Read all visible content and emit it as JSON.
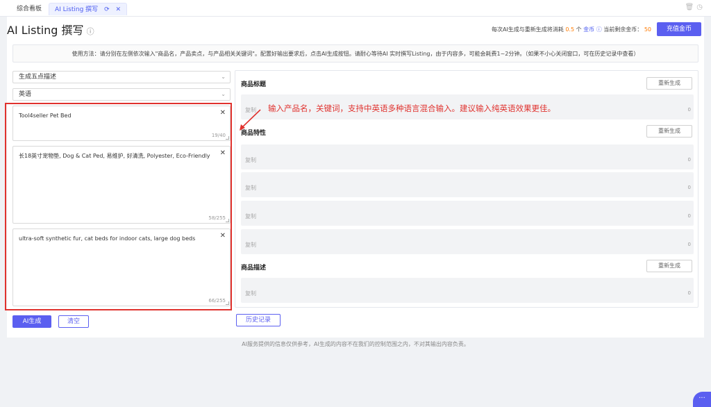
{
  "tabs": [
    {
      "label": "综合看板"
    },
    {
      "label": "AI Listing 撰写",
      "refresh_icon": "⟳",
      "close_icon": "✕"
    }
  ],
  "header": {
    "title": "AI Listing 撰写",
    "cost_prefix": "每次AI生成与重新生成将消耗",
    "cost_value": "0.5",
    "cost_unit": "个",
    "cost_currency": "金币",
    "balance_label": "当前剩余金币：",
    "balance_value": "50",
    "recharge_label": "充值金币"
  },
  "usage_text": "使用方法：请分别在左侧依次输入\"商品名，产品卖点，与产品相关关键词\"。配置好输出要求后，点击AI生成按钮。请耐心等待AI 实时撰写Listing，由于内容多，可能会耗费1~2分钟。（如果不小心关闭窗口，可在历史记录中查看）",
  "left": {
    "select_mode": "生成五点描述",
    "select_language": "英语",
    "inputs": [
      {
        "value": "Tool4seller Pet Bed",
        "count": "19/40"
      },
      {
        "value": "长18英寸宠物垫, Dog & Cat Ped, 易维护, 好清洗, Polyester, Eco-Friendly",
        "count": "58/255"
      },
      {
        "value": "ultra-soft synthetic fur, cat beds for indoor cats, large dog beds",
        "count": "66/255"
      }
    ],
    "generate_label": "AI生成",
    "clear_label": "清空"
  },
  "right": {
    "title_section": "商品标题",
    "features_section": "商品特性",
    "desc_section": "商品描述",
    "regen_label": "重新生成",
    "copy_label": "复制",
    "zero": "0",
    "history_label": "历史记录"
  },
  "annotation": "输入产品名，关键词，支持中英语多种语言混合输入。建议输入纯英语效果更佳。",
  "footer": "AI服务提供的信息仅供参考，AI生成的内容不在我们的控制范围之内，不对其输出内容负责。",
  "colors": {
    "accent": "#5b5ff0",
    "annotation": "#e0322e",
    "cost": "#ff7a00"
  }
}
